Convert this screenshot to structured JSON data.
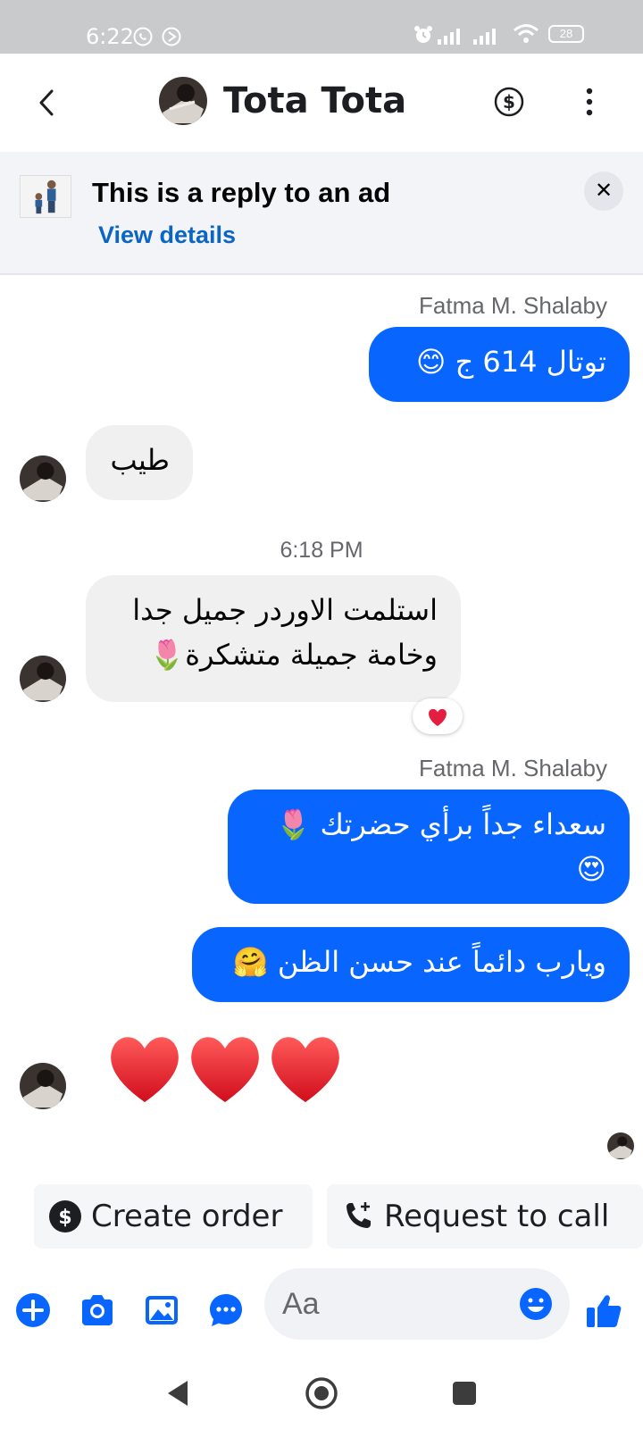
{
  "status_bar": {
    "time": "6:22",
    "battery": "28"
  },
  "header": {
    "title": "Tota Tota"
  },
  "ad_banner": {
    "title": "This is a reply to an ad",
    "link": "View details",
    "close": "✕"
  },
  "messages": {
    "name_1": "Fatma M. Shalaby",
    "out_1": "توتال 614 ج 😊",
    "in_1": "طيب",
    "timestamp": "6:18 PM",
    "in_2_line1": "استلمت الاوردر جميل جدا",
    "in_2_line2": "وخامة جميلة متشكرة🌷",
    "reaction": "❤️",
    "name_2": "Fatma M. Shalaby",
    "out_2_line1": "سعداء جداً برأي حضرتك 🌷",
    "out_2_line2": "😍",
    "out_3": "ويارب دائماً عند حسن الظن 🤗",
    "hearts": "❤️❤️❤️"
  },
  "quick_actions": {
    "create_order": "Create order",
    "request_call": "Request to call"
  },
  "composer": {
    "placeholder": "Aa"
  },
  "colors": {
    "accent": "#0866ff",
    "incoming_bubble": "#f0f0f0",
    "link": "#0a66c2"
  }
}
